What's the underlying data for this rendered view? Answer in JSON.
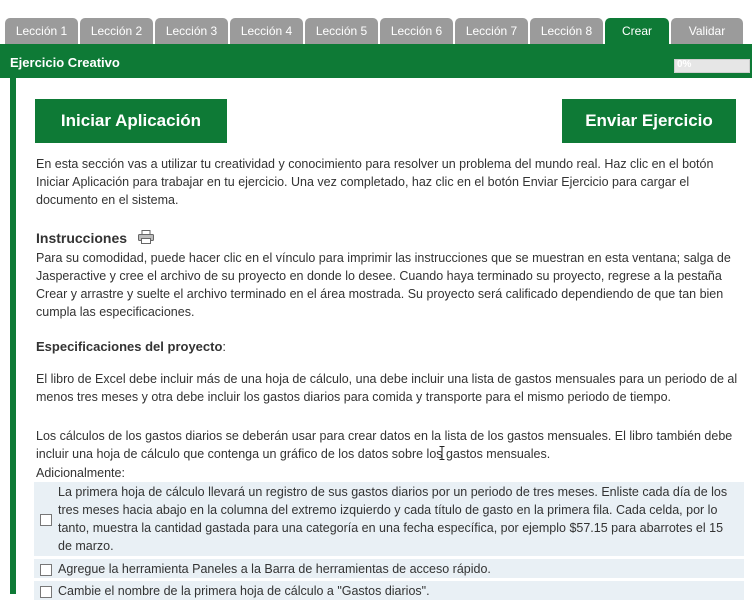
{
  "tabs": [
    {
      "label": "Lección 1"
    },
    {
      "label": "Lección 2"
    },
    {
      "label": "Lección 3"
    },
    {
      "label": "Lección 4"
    },
    {
      "label": "Lección 5"
    },
    {
      "label": "Lección 6"
    },
    {
      "label": "Lección 7"
    },
    {
      "label": "Lección 8"
    },
    {
      "label": "Crear"
    },
    {
      "label": "Validar"
    }
  ],
  "header": {
    "title": "Ejercicio Creativo",
    "progress_label": "0%",
    "progress_fraction": 0
  },
  "buttons": {
    "start": "Iniciar Aplicación",
    "submit": "Enviar Ejercicio"
  },
  "intro": "En esta sección vas a utilizar tu creatividad y conocimiento para resolver un problema del mundo real. Haz clic en el botón Iniciar Aplicación para trabajar en tu ejercicio. Una vez completado, haz clic en el botón Enviar Ejercicio para cargar el documento en el sistema.",
  "instructions": {
    "title": "Instrucciones",
    "body": "Para su comodidad, puede hacer clic en el vínculo para imprimir las instrucciones que se muestran en esta ventana; salga de Jasperactive y cree el archivo de su proyecto en donde lo desee. Cuando haya terminado su proyecto, regrese a la pestaña Crear y arrastre y suelte el archivo terminado en el área mostrada. Su proyecto será calificado dependiendo de que tan bien cumpla las especificaciones."
  },
  "specs": {
    "title": "Especificaciones del proyecto",
    "p1": "El libro de Excel debe incluir más de una hoja de cálculo, una debe incluir una lista de gastos mensuales para un periodo de al menos tres meses y otra debe incluir los gastos diarios para comida y transporte para el mismo periodo de tiempo.",
    "p2": "Los cálculos de los gastos diarios se deberán usar para crear datos en la lista de los gastos mensuales. El libro también debe incluir una hoja de cálculo que contenga un gráfico de los datos sobre los gastos mensuales.",
    "additional": "Adicionalmente:"
  },
  "checklist": [
    {
      "text": "La primera hoja de cálculo llevará un registro de sus gastos diarios por un periodo de tres meses. Enliste cada día de los tres meses hacia abajo en la columna del extremo izquierdo y cada título de gasto en la primera fila. Cada celda, por lo tanto, muestra la cantidad gastada para una categoría en una fecha específica, por ejemplo $57.15 para abarrotes el 15 de marzo."
    },
    {
      "text": "Agregue la herramienta Paneles a la Barra de herramientas de acceso rápido."
    },
    {
      "text": "Cambie el nombre de la primera hoja de cálculo a \"Gastos diarios\"."
    }
  ],
  "colors": {
    "brand_green": "#0e7a36",
    "tab_gray": "#9b9b9b",
    "checklist_bg": "#e9f0f5"
  },
  "icons": {
    "print": "printer-icon",
    "checkbox": "checkbox-icon",
    "cursor": "text-cursor-icon"
  }
}
